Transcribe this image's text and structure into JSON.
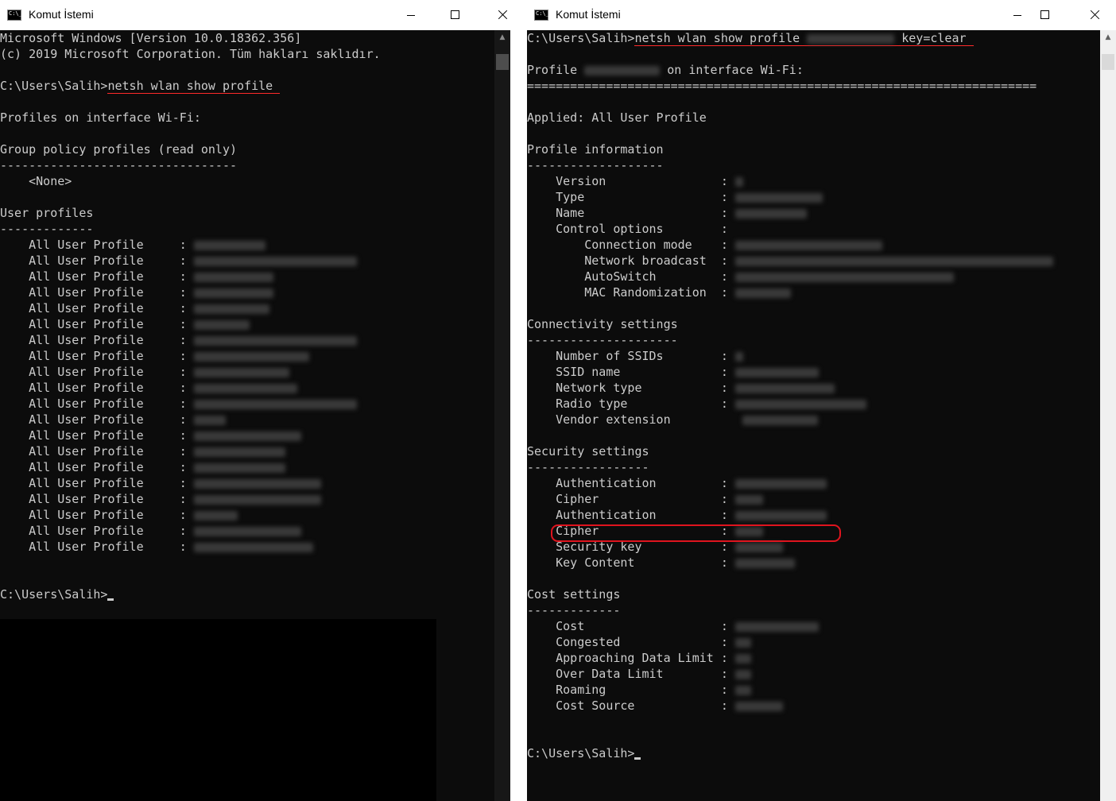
{
  "left_window": {
    "title": "Komut İstemi",
    "lines": [
      {
        "text": "Microsoft Windows [Version 10.0.18362.356]"
      },
      {
        "text": "(c) 2019 Microsoft Corporation. Tüm hakları saklıdır."
      },
      {
        "text": ""
      },
      {
        "text": "C:\\Users\\Salih>",
        "cmd": "netsh wlan show profile "
      },
      {
        "text": ""
      },
      {
        "text": "Profiles on interface Wi-Fi:"
      },
      {
        "text": ""
      },
      {
        "text": "Group policy profiles (read only)"
      },
      {
        "text": "---------------------------------"
      },
      {
        "text": "    <None>"
      },
      {
        "text": ""
      },
      {
        "text": "User profiles"
      },
      {
        "text": "-------------"
      },
      {
        "text": "    All User Profile     : ",
        "blur": 90
      },
      {
        "text": "    All User Profile     : ",
        "blur": 205
      },
      {
        "text": "    All User Profile     : ",
        "blur": 100
      },
      {
        "text": "    All User Profile     : ",
        "blur": 100
      },
      {
        "text": "    All User Profile     : ",
        "blur": 95
      },
      {
        "text": "    All User Profile     : ",
        "blur": 70
      },
      {
        "text": "    All User Profile     : ",
        "blur": 205
      },
      {
        "text": "    All User Profile     : ",
        "blur": 145
      },
      {
        "text": "    All User Profile     : ",
        "blur": 120
      },
      {
        "text": "    All User Profile     : ",
        "blur": 130
      },
      {
        "text": "    All User Profile     : ",
        "blur": 205
      },
      {
        "text": "    All User Profile     : ",
        "blur": 40
      },
      {
        "text": "    All User Profile     : ",
        "blur": 135
      },
      {
        "text": "    All User Profile     : ",
        "blur": 115
      },
      {
        "text": "    All User Profile     : ",
        "blur": 115
      },
      {
        "text": "    All User Profile     : ",
        "blur": 160
      },
      {
        "text": "    All User Profile     : ",
        "blur": 160
      },
      {
        "text": "    All User Profile     : ",
        "blur": 55
      },
      {
        "text": "    All User Profile     : ",
        "blur": 135
      },
      {
        "text": "    All User Profile     : ",
        "blur": 150
      },
      {
        "text": ""
      },
      {
        "text": ""
      },
      {
        "text": "C:\\Users\\Salih>",
        "cursor": true
      }
    ]
  },
  "right_window": {
    "title": "Komut İstemi",
    "lines": [
      {
        "text": "C:\\Users\\Salih>",
        "cmd": "netsh wlan show profile ",
        "cmd_blur": 110,
        "cmd_after": " key=clear "
      },
      {
        "text": ""
      },
      {
        "text": "Profile ",
        "blur": 95,
        "after": " on interface Wi-Fi:"
      },
      {
        "text": "======================================================================="
      },
      {
        "text": ""
      },
      {
        "text": "Applied: All User Profile"
      },
      {
        "text": ""
      },
      {
        "text": "Profile information"
      },
      {
        "text": "-------------------"
      },
      {
        "text": "    Version                : ",
        "blur": 10
      },
      {
        "text": "    Type                   : ",
        "blur": 110
      },
      {
        "text": "    Name                   : ",
        "blur": 90
      },
      {
        "text": "    Control options        : "
      },
      {
        "text": "        Connection mode    : ",
        "blur": 185
      },
      {
        "text": "        Network broadcast  : ",
        "blur": 400
      },
      {
        "text": "        AutoSwitch         : ",
        "blur": 275
      },
      {
        "text": "        MAC Randomization  : ",
        "blur": 70
      },
      {
        "text": ""
      },
      {
        "text": "Connectivity settings"
      },
      {
        "text": "---------------------"
      },
      {
        "text": "    Number of SSIDs        : ",
        "blur": 10
      },
      {
        "text": "    SSID name              : ",
        "blur": 105
      },
      {
        "text": "    Network type           : ",
        "blur": 125
      },
      {
        "text": "    Radio type             : ",
        "blur": 165
      },
      {
        "text": "    Vendor extension          ",
        "blur": 95
      },
      {
        "text": ""
      },
      {
        "text": "Security settings"
      },
      {
        "text": "-----------------"
      },
      {
        "text": "    Authentication         : ",
        "blur": 115
      },
      {
        "text": "    Cipher                 : ",
        "blur": 35
      },
      {
        "text": "    Authentication         : ",
        "blur": 115
      },
      {
        "text": "    Cipher                 : ",
        "blur": 35
      },
      {
        "text": "    Security key           : ",
        "blur": 60
      },
      {
        "text": "    Key Content            : ",
        "blur": 75
      },
      {
        "text": ""
      },
      {
        "text": "Cost settings"
      },
      {
        "text": "-------------"
      },
      {
        "text": "    Cost                   : ",
        "blur": 105
      },
      {
        "text": "    Congested              : ",
        "blur": 20
      },
      {
        "text": "    Approaching Data Limit : ",
        "blur": 20
      },
      {
        "text": "    Over Data Limit        : ",
        "blur": 20
      },
      {
        "text": "    Roaming                : ",
        "blur": 20
      },
      {
        "text": "    Cost Source            : ",
        "blur": 60
      },
      {
        "text": ""
      },
      {
        "text": ""
      },
      {
        "text": "C:\\Users\\Salih>",
        "cursor": true
      }
    ]
  },
  "colors": {
    "console_bg": "#0c0c0c",
    "console_text": "#cccccc",
    "annotation_red": "#e0141e"
  },
  "icons": {
    "app": "cmd-icon",
    "minimize": "minimize-icon",
    "maximize": "maximize-icon",
    "close": "close-icon"
  }
}
